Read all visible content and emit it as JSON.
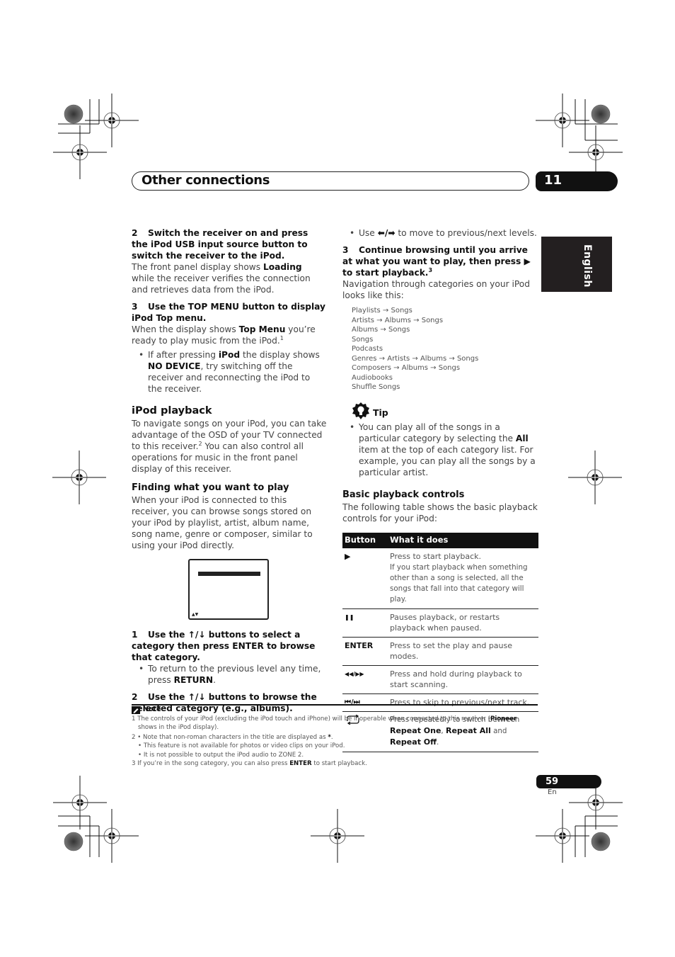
{
  "header": {
    "section_title": "Other connections",
    "chapter_number": "11",
    "language_tab": "English"
  },
  "left_column": {
    "step2": {
      "number": "2",
      "title": "Switch the receiver on and press the iPod USB input source button to switch the receiver to the iPod.",
      "body_before": "The front panel display shows ",
      "body_bold": "Loading",
      "body_after": " while the receiver verifies the connection and retrieves data from the iPod."
    },
    "step3": {
      "number": "3",
      "title": "Use the TOP MENU button to display iPod Top menu.",
      "body_before": "When the display shows ",
      "body_bold": "Top Menu",
      "body_after": " you’re ready to play music from the iPod.",
      "footnote_ref": "1",
      "bullet_p1": "If after pressing ",
      "bullet_b1": "iPod",
      "bullet_p2": " the display shows ",
      "bullet_b2": "NO DEVICE",
      "bullet_p3": ", try switching off the receiver and reconnecting the iPod to the receiver."
    },
    "ipod_playback": {
      "heading": "iPod playback",
      "body_p1": "To navigate songs on your iPod, you can take advantage of the OSD of your TV connected to this receiver.",
      "footnote_ref": "2",
      "body_p2": " You can also control all operations for music in the front panel display of this receiver."
    },
    "finding": {
      "heading": "Finding what you want to play",
      "body": "When your iPod is connected to this receiver, you can browse songs stored on your iPod by playlist, artist, album name, song name, genre or composer, similar to using your iPod directly.",
      "osd_scroll_indicator": "▲▼"
    },
    "step1_browse": {
      "number": "1",
      "title_p1": "Use the ",
      "arrows": "↑/↓",
      "title_p2": " buttons to select a category then press ENTER to browse that category.",
      "bullet_p1": "To return to the previous level any time, press ",
      "bullet_b1": "RETURN",
      "bullet_p2": "."
    },
    "step2_browse": {
      "number": "2",
      "title_p1": "Use the ",
      "arrows": "↑/↓",
      "title_p2": " buttons to browse the selected category (e.g., albums)."
    }
  },
  "right_column": {
    "levels_bullet": {
      "p1": "Use ",
      "arrows": "⬅/➡",
      "p2": " to move to previous/next levels."
    },
    "step3_continue": {
      "number": "3",
      "title": "Continue browsing until you arrive at what you want to play, then press ▶ to start playback.",
      "footnote_ref": "3",
      "body": "Navigation through categories on your iPod looks like this:"
    },
    "navigation_paths": [
      "Playlists → Songs",
      "Artists → Albums → Songs",
      "Albums → Songs",
      "Songs",
      "Podcasts",
      "Genres → Artists → Albums → Songs",
      "Composers → Albums → Songs",
      "Audiobooks",
      "Shuffle Songs"
    ],
    "tip": {
      "label": "Tip",
      "p1": "You can play all of the songs in a particular category by selecting the ",
      "bold": "All",
      "p2": " item at the top of each category list. For example, you can play all the songs by a particular artist."
    },
    "basic_controls": {
      "heading": "Basic playback controls",
      "intro": "The following table shows the basic playback controls for your iPod:",
      "table": {
        "headers": [
          "Button",
          "What it does"
        ],
        "rows": [
          {
            "button": "▶",
            "line1": "Press to start playback.",
            "line2": "If you start playback when something other than a song is selected, all the songs that fall into that category will play."
          },
          {
            "button": "❚❚",
            "line1": "Pauses playback, or restarts playback when paused."
          },
          {
            "button": "ENTER",
            "line1": "Press to set the play and pause modes."
          },
          {
            "button": "◀◀/▶▶",
            "line1": "Press and hold during playback to start scanning."
          },
          {
            "button": "⏮/⏭",
            "line1": "Press to skip to previous/next track."
          },
          {
            "button": "repeat-icon",
            "p1": "Press repeatedly to switch between ",
            "b1": "Repeat One",
            "p2": ", ",
            "b2": "Repeat All",
            "p3": " and ",
            "b3": "Repeat Off",
            "p4": "."
          }
        ]
      }
    }
  },
  "notes": {
    "label": "Note",
    "n1_num": "1",
    "n1_p1": "The controls of your iPod (excluding the iPod touch and iPhone) will be inoperable when connected to this receiver (",
    "n1_b1": "Pioneer",
    "n1_p2": " shows in the iPod display).",
    "n2_num": "2",
    "n2_items": [
      "Note that non-roman characters in the title are displayed as ",
      "This feature is not available for photos or video clips on your iPod.",
      "It is not possible to output the iPod audio to ZONE 2."
    ],
    "n2_star": "*",
    "n3_num": "3",
    "n3_p1": "If you’re in the song category, you can also press ",
    "n3_b1": "ENTER",
    "n3_p2": " to start playback."
  },
  "footer": {
    "page_number": "59",
    "language_code": "En"
  }
}
